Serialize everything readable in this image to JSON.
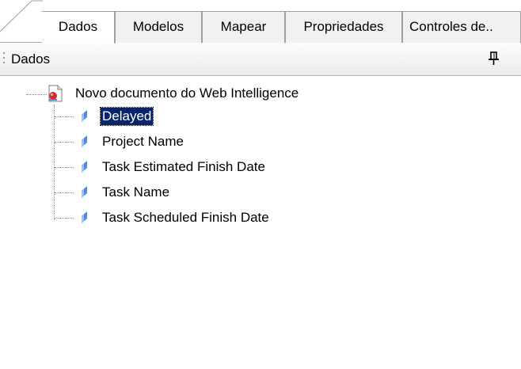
{
  "tabs": [
    {
      "label": "Dados",
      "active": true
    },
    {
      "label": "Modelos",
      "active": false
    },
    {
      "label": "Mapear",
      "active": false
    },
    {
      "label": "Propriedades",
      "active": false
    },
    {
      "label": "Controles de..",
      "active": false
    }
  ],
  "panel": {
    "title": "Dados",
    "pin_icon": "pin-icon"
  },
  "tree": {
    "root": {
      "label": "Novo documento do Web Intelligence",
      "icon": "web-intelligence-document-icon"
    },
    "items": [
      {
        "label": "Delayed",
        "icon": "dimension-field-icon",
        "selected": true
      },
      {
        "label": "Project Name",
        "icon": "dimension-field-icon",
        "selected": false
      },
      {
        "label": "Task Estimated Finish Date",
        "icon": "dimension-field-icon",
        "selected": false
      },
      {
        "label": "Task Name",
        "icon": "dimension-field-icon",
        "selected": false
      },
      {
        "label": "Task Scheduled Finish Date",
        "icon": "dimension-field-icon",
        "selected": false
      }
    ]
  },
  "colors": {
    "selection_bg": "#0a246a",
    "field_icon": "#4a8fd6",
    "doc_icon_accent": "#d62b2b"
  }
}
